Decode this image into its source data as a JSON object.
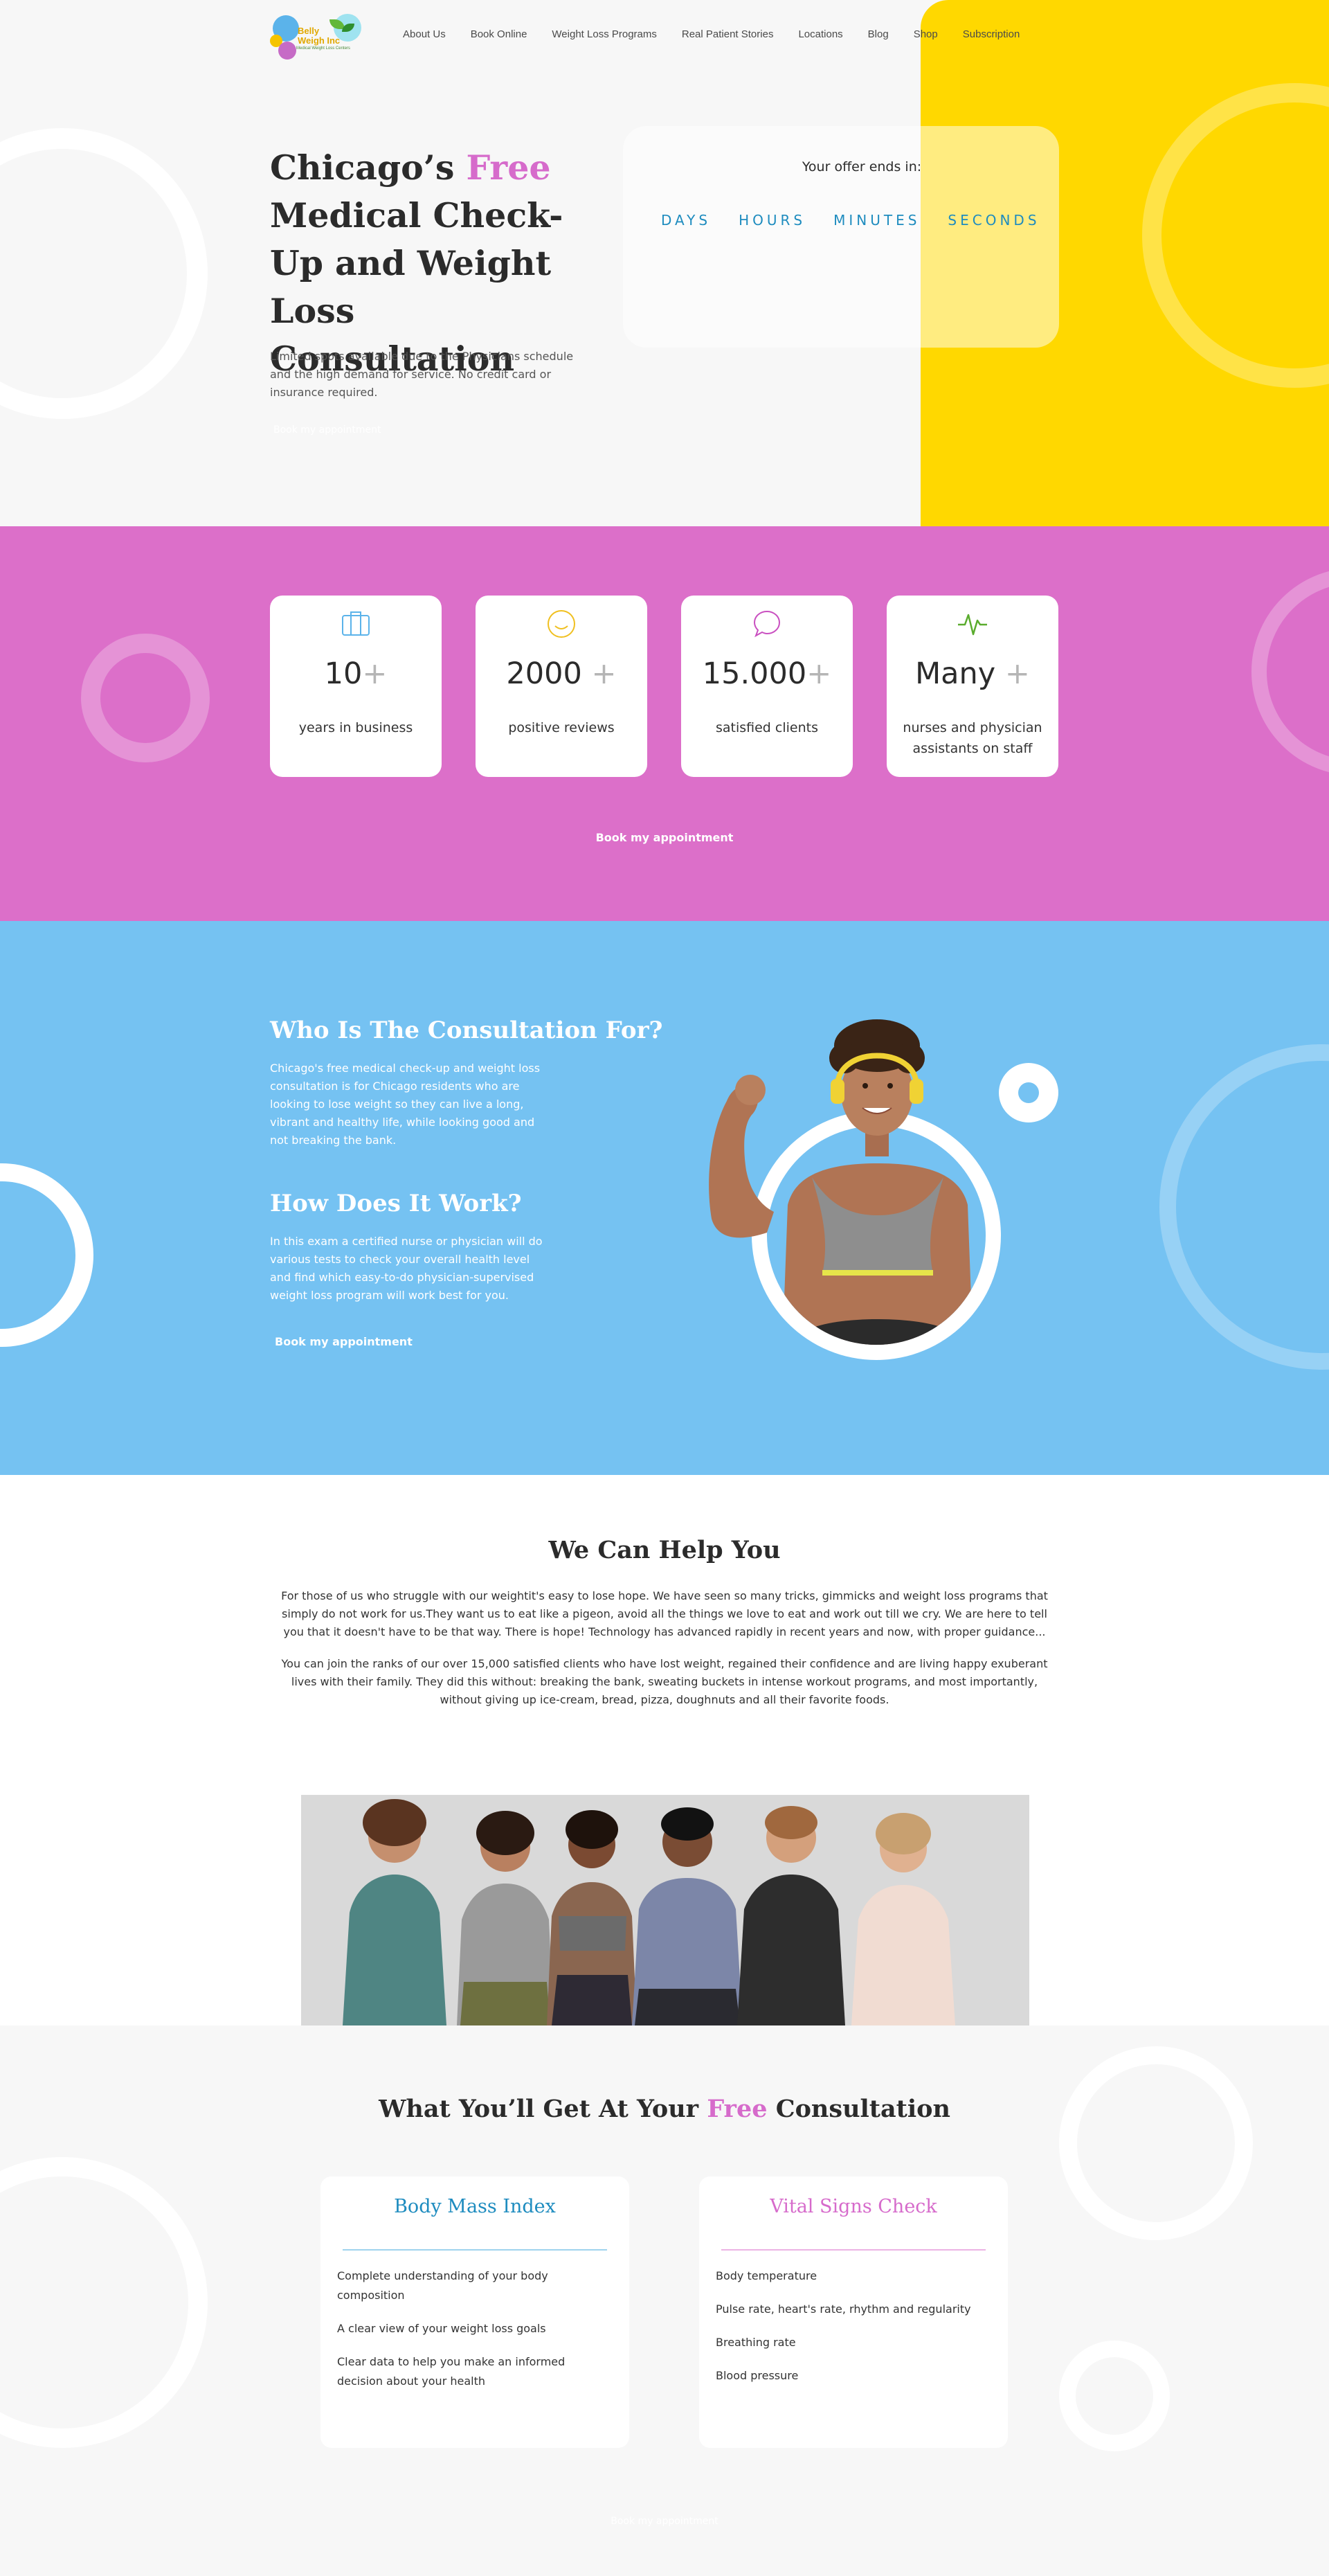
{
  "brand": {
    "logo_line1": "Belly",
    "logo_line2": "Weigh Inc",
    "logo_tagline": "Medical Weight Loss Centers"
  },
  "nav": {
    "items": [
      "About Us",
      "Book Online",
      "Weight Loss Programs",
      "Real Patient Stories",
      "Locations",
      "Blog",
      "Shop",
      "Subscription"
    ]
  },
  "hero": {
    "title_part1": "Chicago’s ",
    "title_accent": "Free",
    "title_part2": "Medical Check-Up and Weight Loss Consultation",
    "description": "Limited spots available due to the Physicians schedule and the high demand for service. No credit card or insurance required.",
    "cta_label": "Book my appointment",
    "offer_title": "Your offer ends in:",
    "countdown_labels": [
      "DAYS",
      "HOURS",
      "MINUTES",
      "SECONDS"
    ]
  },
  "stats": {
    "cards": [
      {
        "icon": "briefcase-icon",
        "number": "10",
        "plus": "+",
        "label": "years in business"
      },
      {
        "icon": "smile-icon",
        "number": "2000 ",
        "plus": "+",
        "label": "positive reviews"
      },
      {
        "icon": "chat-bubble-icon",
        "number": "15.000",
        "plus": "+",
        "label": "satisfied clients"
      },
      {
        "icon": "heartbeat-icon",
        "number": "Many ",
        "plus": "+",
        "label": "nurses and physician assistants on staff"
      }
    ],
    "cta_label": "Book my appointment"
  },
  "consult": {
    "who_title": "Who Is The Consultation For?",
    "who_text": "Chicago's free medical check-up and weight loss consultation is for Chicago residents who are looking to lose weight so they can live a long, vibrant and healthy life, while looking good and not breaking the bank.",
    "how_title": "How Does It Work?",
    "how_text": "In this exam a certified nurse or physician will do various tests to check your overall health level and find which easy-to-do physician-supervised weight loss program will work best for you.",
    "cta_label": "Book my appointment"
  },
  "help": {
    "title": "We Can Help You",
    "paragraph1": "For those of us who struggle with our weightit's easy to lose hope. We have seen so many tricks, gimmicks and weight loss programs that simply do not work for us.They want us to eat like a pigeon, avoid all the things we love to eat and work out till we cry. We are here to tell you that it doesn't have to be that way. There is hope! Technology has advanced rapidly in recent years and now, with proper guidance...",
    "paragraph2": "You can join the ranks of our over 15,000 satisfied clients who have lost weight, regained their confidence and are living happy exuberant lives with their family. They did this without: breaking the bank, sweating buckets in intense workout programs, and most importantly, without giving up ice-cream, bread, pizza, doughnuts and all their favorite foods."
  },
  "get": {
    "title_part1": "What You’ll Get At Your ",
    "title_accent": "Free",
    "title_part2": " Consultation",
    "cards": [
      {
        "title": "Body Mass Index",
        "color": "#1e8cbf",
        "line_color": "#9fd3ee",
        "items": [
          "Complete understanding of your body composition",
          "A clear view of your weight loss goals",
          "Clear data to help you make an informed decision about your health"
        ]
      },
      {
        "title": "Vital Signs Check",
        "color": "#d66bcb",
        "line_color": "#ecb3e4",
        "items": [
          "Body temperature",
          "Pulse rate, heart's rate, rhythm and regularity",
          "Breathing rate",
          "Blood pressure"
        ]
      }
    ],
    "cta_label": "Book my appointment"
  },
  "colors": {
    "pink": "#dc6fc9",
    "blue": "#75c2f2",
    "yellow": "#ffd800",
    "accent_blue": "#1e8cbf",
    "accent_pink": "#d66bcb"
  }
}
